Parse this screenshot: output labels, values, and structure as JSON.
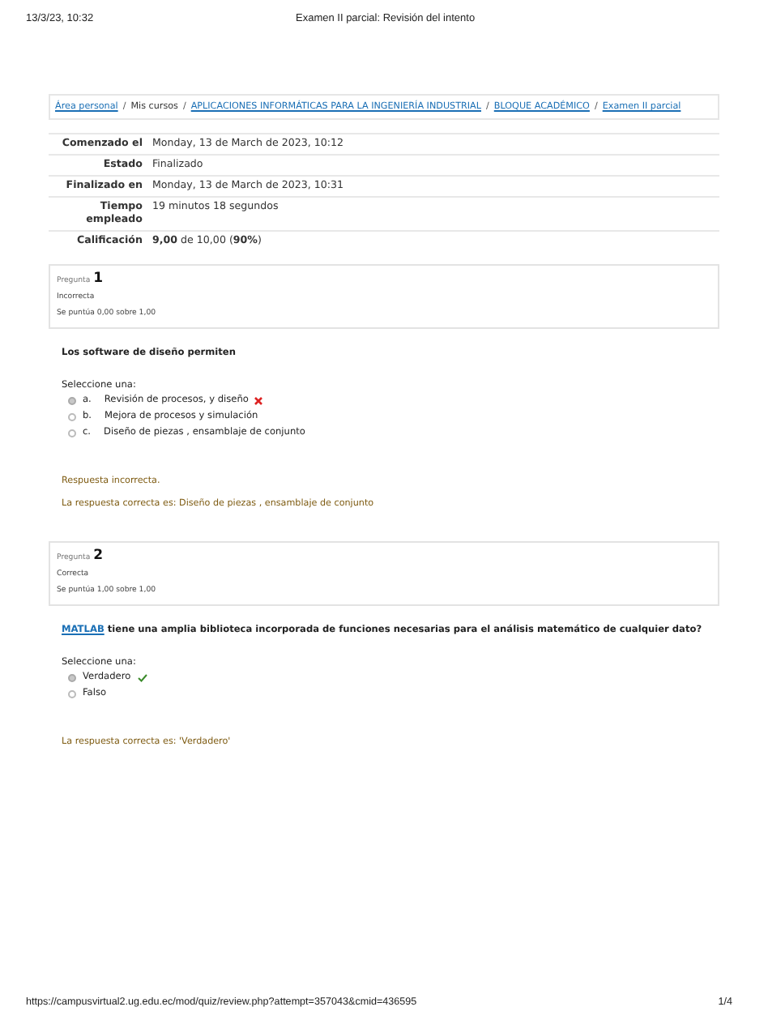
{
  "print_header": {
    "date": "13/3/23, 10:32",
    "title": "Examen II parcial: Revisión del intento"
  },
  "breadcrumb_separator": "/",
  "breadcrumb": [
    {
      "label": "Área personal",
      "kind": "link"
    },
    {
      "label": "Mis cursos",
      "kind": "text"
    },
    {
      "label": "APLICACIONES INFORMÁTICAS PARA LA INGENIERÍA INDUSTRIAL",
      "kind": "link"
    },
    {
      "label": "BLOQUE ACADÉMICO",
      "kind": "link"
    },
    {
      "label": "Examen II parcial",
      "kind": "link"
    }
  ],
  "summary": [
    {
      "label": "Comenzado el",
      "value": "Monday, 13 de March de 2023, 10:12"
    },
    {
      "label": "Estado",
      "value": "Finalizado"
    },
    {
      "label": "Finalizado en",
      "value": "Monday, 13 de March de 2023, 10:31"
    },
    {
      "label": "Tiempo empleado",
      "value": "19 minutos 18 segundos"
    },
    {
      "label": "Calificación",
      "value": "**9,00** de 10,00 (**90%**)"
    }
  ],
  "questions": [
    {
      "caption": "Pregunta",
      "number": "1",
      "state": "Incorrecta",
      "mark": "Se puntúa 0,00 sobre 1,00",
      "text": "Los software de diseño permiten",
      "prompt": "Seleccione una:",
      "options": [
        {
          "letter": "a.",
          "label": "Revisión de procesos, y diseño",
          "selected": true,
          "kind": "wrong"
        },
        {
          "letter": "b.",
          "label": "Mejora de procesos y simulación",
          "selected": false,
          "kind": "plain"
        },
        {
          "letter": "c.",
          "label": "Diseño de piezas , ensamblaje de conjunto",
          "selected": false,
          "kind": "plain"
        }
      ],
      "feedback": [
        "Respuesta incorrecta.",
        "La respuesta correcta es: Diseño de piezas , ensamblaje de conjunto"
      ]
    },
    {
      "caption": "Pregunta",
      "number": "2",
      "state": "Correcta",
      "mark": "Se puntúa 1,00 sobre 1,00",
      "text_link": "MATLAB",
      "text": "tiene una amplia  biblioteca incorporada de funciones necesarias para el análisis matemático de cualquier dato?",
      "prompt": "Seleccione una:",
      "options": [
        {
          "label": "Verdadero",
          "selected": true,
          "kind": "right"
        },
        {
          "label": "Falso",
          "selected": false,
          "kind": "plain"
        }
      ],
      "feedback": [
        "La respuesta correcta es: 'Verdadero'"
      ]
    }
  ],
  "footer": {
    "url": "https://campusvirtual2.ug.edu.ec/mod/quiz/review.php?attempt=357043&cmid=436595",
    "page": "1/4"
  }
}
